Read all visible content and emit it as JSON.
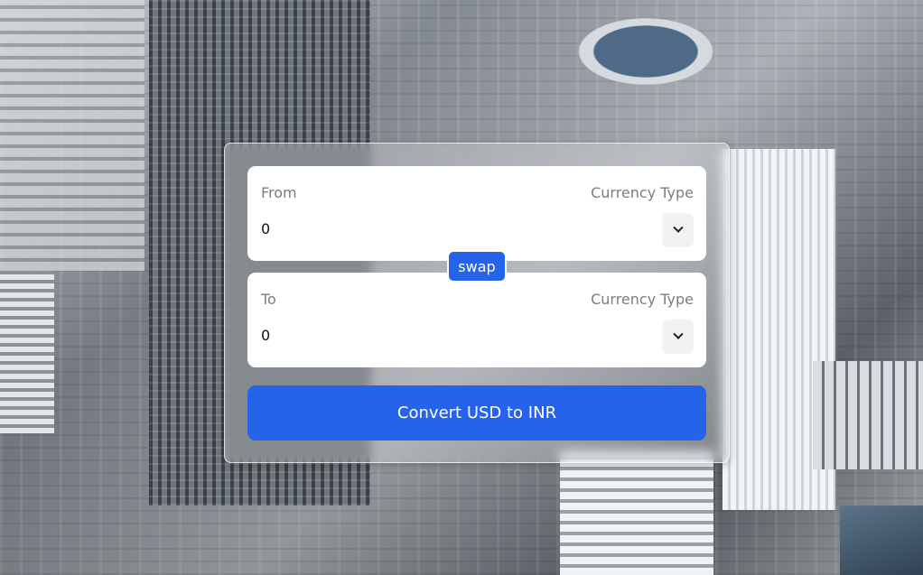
{
  "from": {
    "label": "From",
    "type_label": "Currency Type",
    "amount": "0",
    "select_icon": "chevron-down-icon"
  },
  "swap_label": "swap",
  "to": {
    "label": "To",
    "type_label": "Currency Type",
    "amount": "0",
    "select_icon": "chevron-down-icon"
  },
  "convert_label": "Convert USD to INR",
  "colors": {
    "accent": "#2563eb",
    "field_bg": "#ffffff",
    "label_text": "#7a7e83"
  }
}
